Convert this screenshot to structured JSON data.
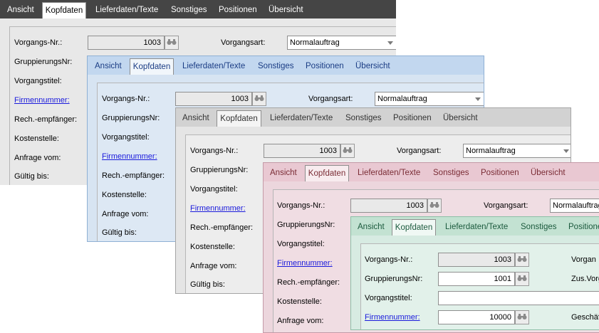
{
  "tabs": [
    "Ansicht",
    "Kopfdaten",
    "Lieferdaten/Texte",
    "Sonstiges",
    "Positionen",
    "Übersicht"
  ],
  "active_tab": "Kopfdaten",
  "labels": {
    "vorgangsnr": "Vorgangs-Nr.:",
    "gruppierungsnr": "GruppierungsNr:",
    "vorgangstitel": "Vorgangstitel:",
    "firmennummer": "Firmennummer:",
    "rechempfaenger": "Rech.-empfänger:",
    "kostenstelle": "Kostenstelle:",
    "anfrage": "Anfrage vom:",
    "gueltig": "Gültig bis:",
    "vorgangsart": "Vorgangsart:",
    "vorgangsart_cut": "Vorgan",
    "zusvorg_cut": "Zus.Vorg",
    "geschaeft_cut": "Geschäf"
  },
  "values": {
    "vorgangsnr": "1003",
    "gruppierungsnr": "1001",
    "firmennummer": "10000",
    "vorgangsart": "Normalauftrag"
  },
  "themes": {
    "dark": "#454545",
    "blue": "#c2d7ef",
    "silver": "#d2d2d2",
    "rose": "#e9c8d2",
    "mint": "#c3e2d2"
  }
}
